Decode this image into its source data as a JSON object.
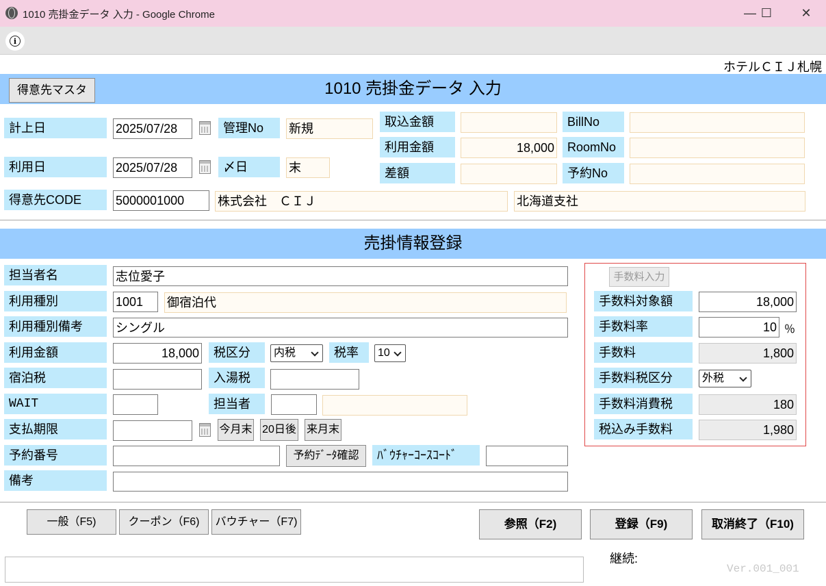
{
  "window": {
    "title": "1010 売掛金データ 入力 - Google Chrome",
    "minimize": "—",
    "maximize": "☐",
    "close": "✕"
  },
  "hotel_name": "ホテルＣＩＪ札幌",
  "header": {
    "title": "1010  売掛金データ  入力",
    "master_button": "得意先マスタ"
  },
  "top": {
    "record_date_label": "計上日",
    "record_date": "2025/07/28",
    "mgmt_no_label": "管理No",
    "mgmt_no": "新規",
    "import_amount_label": "取込金額",
    "import_amount": "",
    "bill_no_label": "BillNo",
    "bill_no": "",
    "use_date_label": "利用日",
    "use_date": "2025/07/28",
    "close_day_label": "〆日",
    "close_day": "末",
    "use_amount_label": "利用金額",
    "use_amount": "18,000",
    "room_no_label": "RoomNo",
    "room_no": "",
    "diff_label": "差額",
    "diff": "",
    "reserve_no_label": "予約No",
    "reserve_no": "",
    "customer_code_label": "得意先CODE",
    "customer_code": "5000001000",
    "customer_name": "株式会社　ＣＩＪ",
    "customer_branch": "北海道支社"
  },
  "section2_title": "売掛情報登録",
  "form": {
    "staff_name_label": "担当者名",
    "staff_name": "志位愛子",
    "use_type_label": "利用種別",
    "use_type_code": "1001",
    "use_type_name": "御宿泊代",
    "use_type_note_label": "利用種別備考",
    "use_type_note": "シングル",
    "amount_label": "利用金額",
    "amount": "18,000",
    "tax_type_label": "税区分",
    "tax_type": "内税",
    "tax_rate_label": "税率",
    "tax_rate": "10",
    "lodging_tax_label": "宿泊税",
    "lodging_tax": "",
    "bath_tax_label": "入湯税",
    "bath_tax": "",
    "wait_label": "WAIT",
    "wait": "",
    "person_label": "担当者",
    "person_code": "",
    "person_name": "",
    "pay_deadline_label": "支払期限",
    "pay_deadline": "",
    "this_month_end_btn": "今月末",
    "after20_btn": "20日後",
    "next_month_end_btn": "来月末",
    "reserve_no_label": "予約番号",
    "reserve_no": "",
    "reserve_check_btn": "予約ﾃﾞｰﾀ確認",
    "voucher_code_label": "ﾊﾞｳﾁｬｰｺｰｽｺｰﾄﾞ",
    "voucher_code": "",
    "note_label": "備考",
    "note": ""
  },
  "fee": {
    "input_btn": "手数料入力",
    "target_label": "手数料対象額",
    "target": "18,000",
    "rate_label": "手数料率",
    "rate": "10",
    "rate_unit": "％",
    "fee_label": "手数料",
    "fee": "1,800",
    "tax_type_label": "手数料税区分",
    "tax_type": "外税",
    "tax_label": "手数料消費税",
    "tax": "180",
    "total_label": "税込み手数料",
    "total": "1,980"
  },
  "footer": {
    "general_btn": "一般（F5)",
    "coupon_btn": "クーポン（F6)",
    "voucher_btn": "バウチャー（F7)",
    "ref_btn": "参照（F2)",
    "register_btn": "登録（F9)",
    "cancel_btn": "取消終了（F10)",
    "continue_label": "継続:",
    "version": "Ver.001_001"
  }
}
